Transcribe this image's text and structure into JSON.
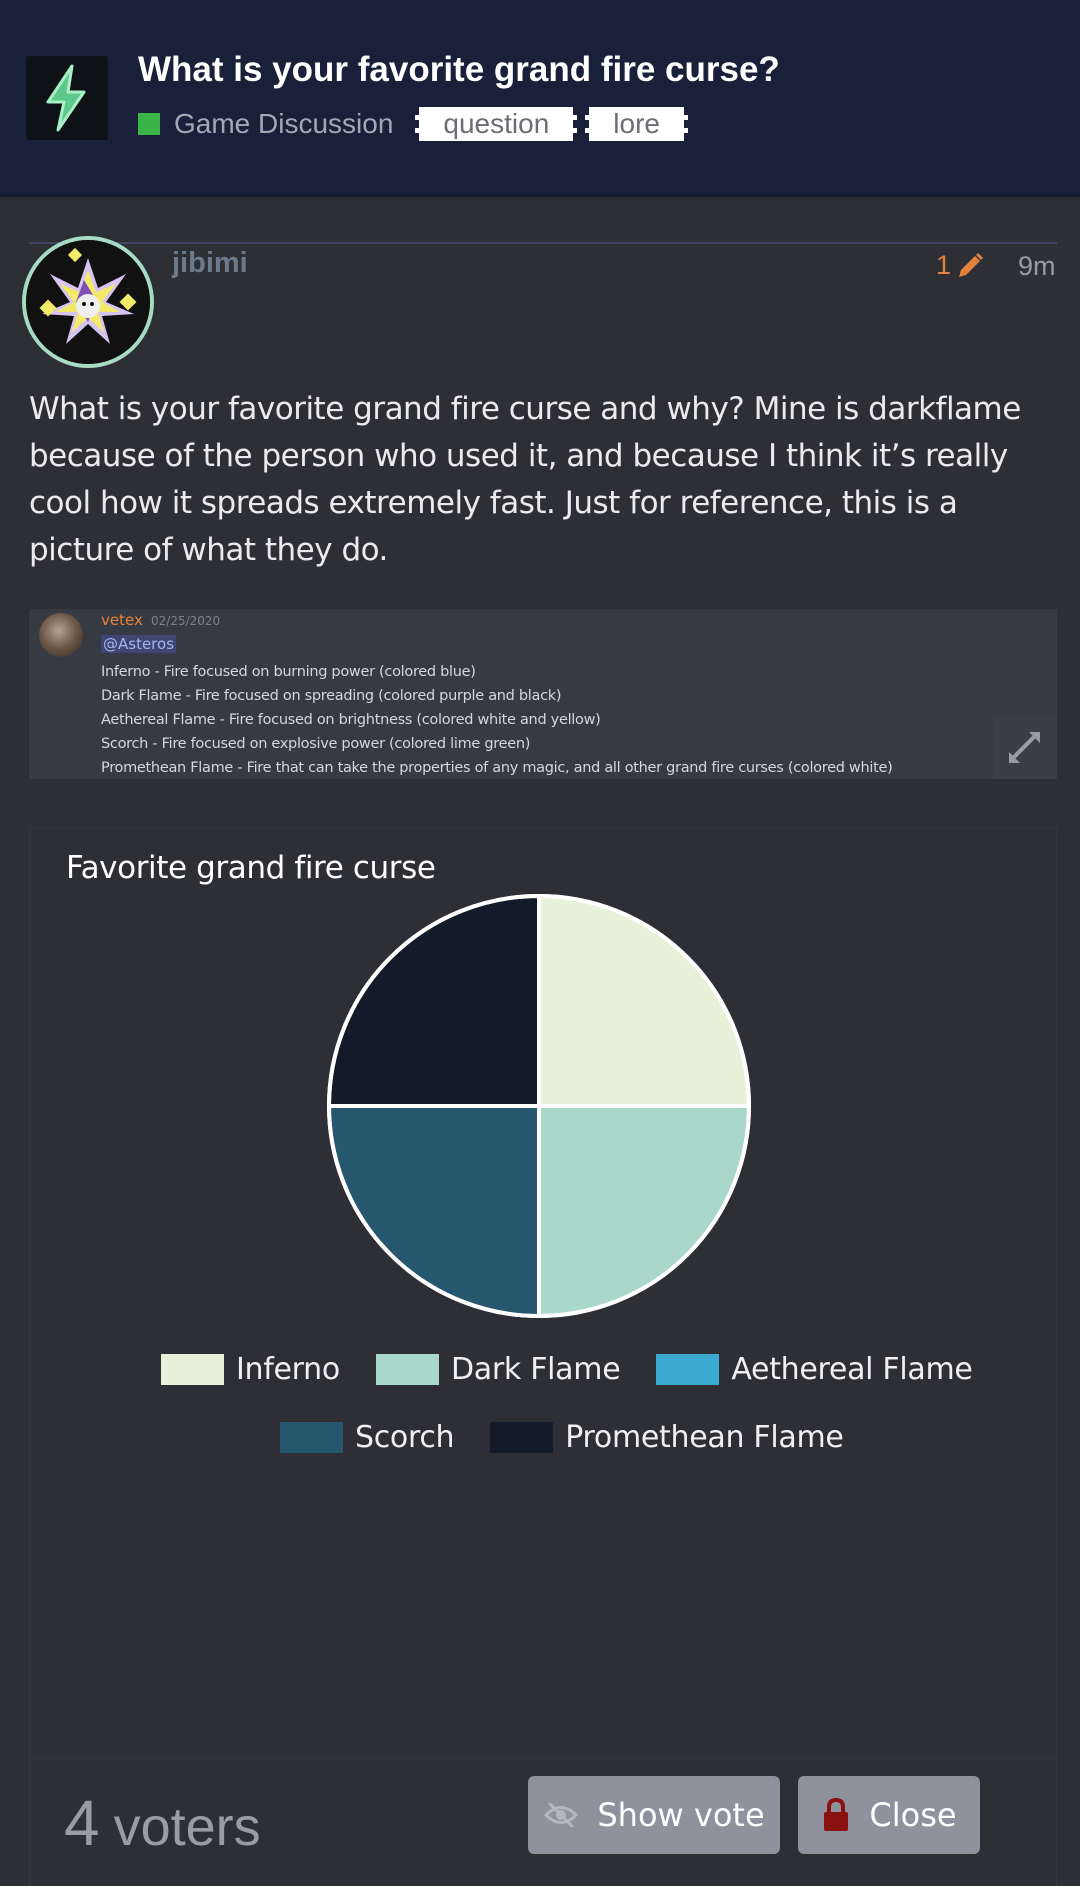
{
  "topic": {
    "title": "What is your favorite grand fire curse?",
    "category": "Game Discussion",
    "category_color": "#3ab54a",
    "tags": [
      "question",
      "lore"
    ]
  },
  "post": {
    "username": "jibimi",
    "edit_count": "1",
    "time": "9m",
    "body": "What is your favorite grand fire curse and why? Mine is darkflame because of the person who used it, and because I think it’s really cool how it spreads extremely fast. Just for reference, this is a picture of what they do."
  },
  "embed": {
    "author": "vetex",
    "date": "02/25/2020",
    "mention": "@Asteros",
    "lines": [
      "Inferno - Fire focused on burning power (colored blue)",
      "Dark Flame - Fire focused on spreading (colored purple and black)",
      "Aethereal Flame - Fire focused on brightness (colored white and yellow)",
      "Scorch - Fire focused on explosive power (colored lime green)",
      "Promethean Flame - Fire that can take the properties of any magic, and all other grand fire curses (colored white)"
    ]
  },
  "poll": {
    "voters_count": "4",
    "voters_label": "voters",
    "show_vote_label": "Show vote",
    "close_label": "Close"
  },
  "chart_data": {
    "type": "pie",
    "title": "Favorite grand fire curse",
    "categories": [
      "Inferno",
      "Dark Flame",
      "Aethereal Flame",
      "Scorch",
      "Promethean Flame"
    ],
    "values": [
      1,
      1,
      0,
      1,
      1
    ],
    "colors": [
      "#e8f2da",
      "#a9d8ca",
      "#3aaad0",
      "#27566f",
      "#131a29"
    ],
    "legend_placement": "bottom"
  }
}
